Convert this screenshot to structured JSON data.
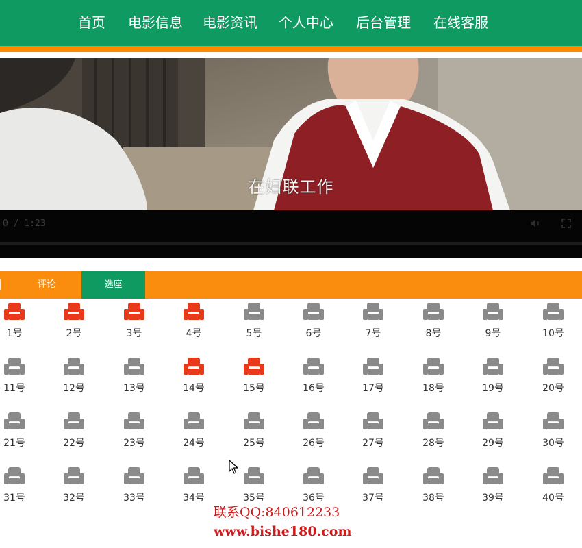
{
  "nav": {
    "items": [
      {
        "label": "首页"
      },
      {
        "label": "电影信息"
      },
      {
        "label": "电影资讯"
      },
      {
        "label": "个人中心"
      },
      {
        "label": "后台管理"
      },
      {
        "label": "在线客服"
      }
    ]
  },
  "video": {
    "subtitle": "在妇联工作",
    "time": "0 / 1:23",
    "progress": 0
  },
  "tabs": {
    "comment": "评论",
    "seat": "选座"
  },
  "seats": [
    {
      "label": "1号",
      "booked": true
    },
    {
      "label": "2号",
      "booked": true
    },
    {
      "label": "3号",
      "booked": true
    },
    {
      "label": "4号",
      "booked": true
    },
    {
      "label": "5号",
      "booked": false
    },
    {
      "label": "6号",
      "booked": false
    },
    {
      "label": "7号",
      "booked": false
    },
    {
      "label": "8号",
      "booked": false
    },
    {
      "label": "9号",
      "booked": false
    },
    {
      "label": "10号",
      "booked": false
    },
    {
      "label": "11号",
      "booked": false
    },
    {
      "label": "12号",
      "booked": false
    },
    {
      "label": "13号",
      "booked": false
    },
    {
      "label": "14号",
      "booked": true
    },
    {
      "label": "15号",
      "booked": true
    },
    {
      "label": "16号",
      "booked": false
    },
    {
      "label": "17号",
      "booked": false
    },
    {
      "label": "18号",
      "booked": false
    },
    {
      "label": "19号",
      "booked": false
    },
    {
      "label": "20号",
      "booked": false
    },
    {
      "label": "21号",
      "booked": false
    },
    {
      "label": "22号",
      "booked": false
    },
    {
      "label": "23号",
      "booked": false
    },
    {
      "label": "24号",
      "booked": false
    },
    {
      "label": "25号",
      "booked": false
    },
    {
      "label": "26号",
      "booked": false
    },
    {
      "label": "27号",
      "booked": false
    },
    {
      "label": "28号",
      "booked": false
    },
    {
      "label": "29号",
      "booked": false
    },
    {
      "label": "30号",
      "booked": false
    },
    {
      "label": "31号",
      "booked": false
    },
    {
      "label": "32号",
      "booked": false
    },
    {
      "label": "33号",
      "booked": false
    },
    {
      "label": "34号",
      "booked": false
    },
    {
      "label": "35号",
      "booked": false
    },
    {
      "label": "36号",
      "booked": false
    },
    {
      "label": "37号",
      "booked": false
    },
    {
      "label": "38号",
      "booked": false
    },
    {
      "label": "39号",
      "booked": false
    },
    {
      "label": "40号",
      "booked": false
    }
  ],
  "watermark": {
    "line1": "联系QQ:840612233",
    "line2": "www.bishe180.com"
  },
  "colors": {
    "brand_green": "#0f9a62",
    "accent_orange": "#fa8c0e",
    "seat_booked": "#e8391b",
    "seat_free": "#8a8a8a"
  },
  "icons": {
    "seat": "armchair-icon",
    "volume": "volume-icon",
    "fullscreen": "fullscreen-icon",
    "cursor": "mouse-pointer-icon"
  }
}
